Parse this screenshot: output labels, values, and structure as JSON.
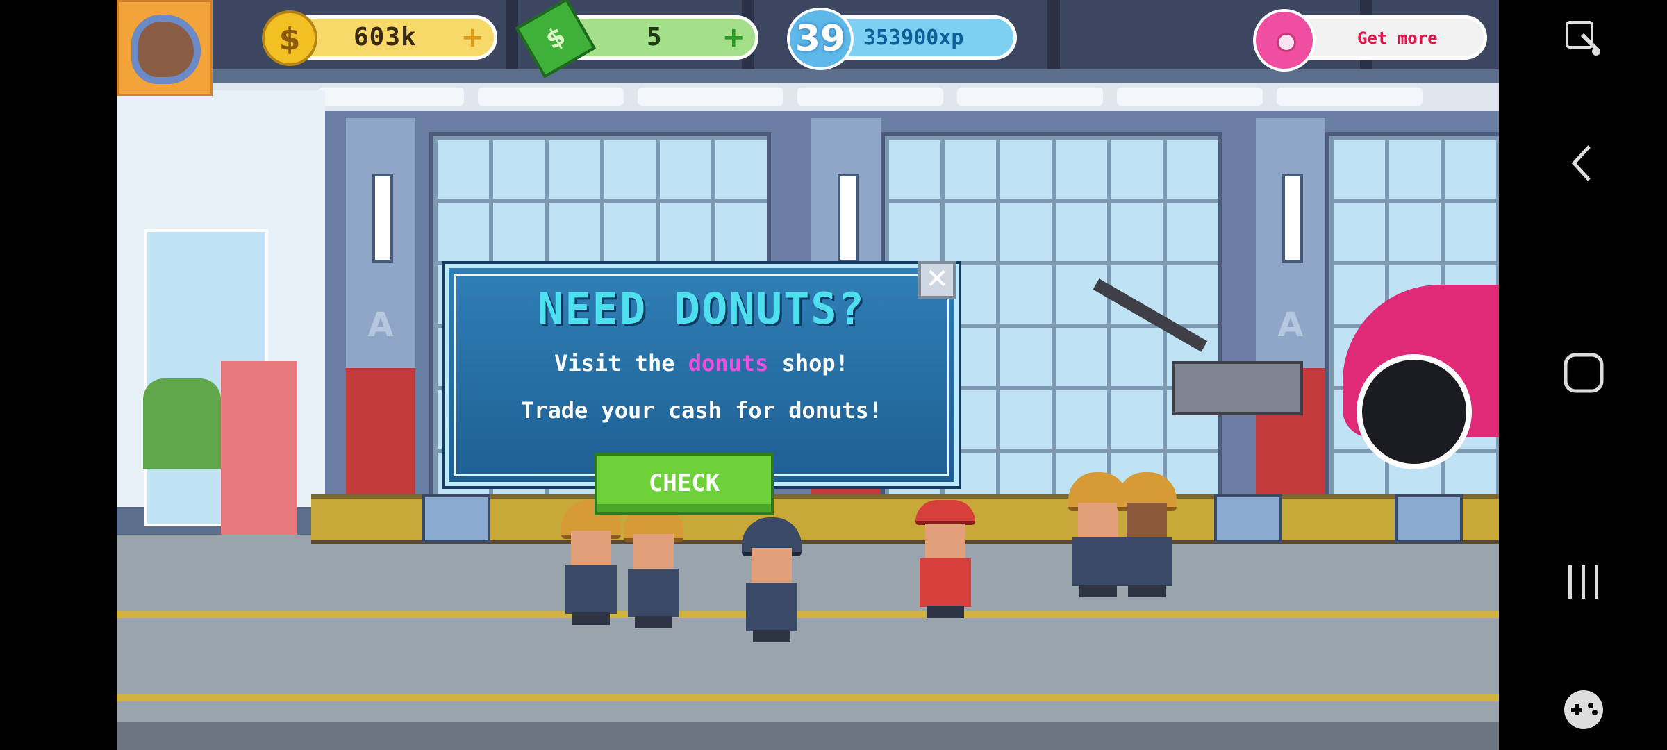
{
  "hud": {
    "cash": {
      "value": "603k",
      "icon": "dollar-coin-icon",
      "plus": "+"
    },
    "bills": {
      "value": "5",
      "icon": "cash-bills-icon",
      "plus": "+"
    },
    "level": {
      "number": "39",
      "xp": "353900xp"
    },
    "donuts": {
      "label": "Get more",
      "icon": "donut-icon"
    }
  },
  "dialog": {
    "title": "NEED DONUTS?",
    "line1_prefix": "Visit the ",
    "line1_highlight": "donuts",
    "line1_suffix": " shop!",
    "line2": "Trade your cash for donuts!",
    "check_label": "CHECK",
    "close_glyph": "✕"
  },
  "colors": {
    "dialog_title": "#4fe0f0",
    "highlight": "#f04ee0",
    "check_button": "#6fd13a",
    "donut_label": "#e0154a"
  },
  "system_nav": {
    "icons": [
      "screenshot-tool-icon",
      "back-icon",
      "home-icon",
      "recents-icon",
      "game-launcher-icon"
    ]
  }
}
